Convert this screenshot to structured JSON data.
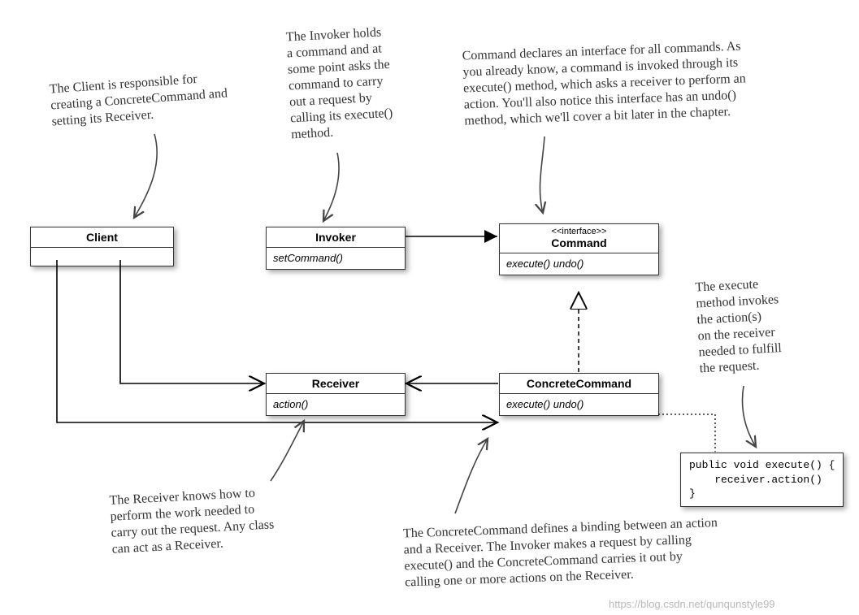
{
  "classes": {
    "client": {
      "name": "Client",
      "body": ""
    },
    "invoker": {
      "name": "Invoker",
      "body": "setCommand()"
    },
    "command": {
      "stereo": "<<interface>>",
      "name": "Command",
      "body": "execute()\nundo()"
    },
    "receiver": {
      "name": "Receiver",
      "body": "action()"
    },
    "concrete": {
      "name": "ConcreteCommand",
      "body": "execute()\nundo()"
    }
  },
  "notes": {
    "client": "The Client is responsible for\ncreating a ConcreteCommand and\nsetting its Receiver.",
    "invoker": "The Invoker holds\na command and at\nsome point asks the\ncommand to carry\nout a request by\ncalling its execute()\nmethod.",
    "command": "Command declares an interface for all commands. As\nyou already know, a command is invoked through its\nexecute() method, which asks a receiver to perform an\naction.  You'll also notice this interface has an undo()\nmethod, which we'll cover a bit later in the chapter.",
    "execute": "The execute\nmethod invokes\nthe action(s)\non the receiver\nneeded to fulfill\nthe request.",
    "receiver": "The Receiver knows how to\nperform the work needed to\ncarry out the request.  Any class\ncan act as a Receiver.",
    "concrete": "The ConcreteCommand defines a binding between an action\nand a Receiver.  The Invoker makes a request by calling\nexecute() and the ConcreteCommand carries it out by\ncalling one or more actions on the Receiver."
  },
  "code": "public void execute() {\n    receiver.action()\n}",
  "watermark": "https://blog.csdn.net/qunqunstyle99"
}
